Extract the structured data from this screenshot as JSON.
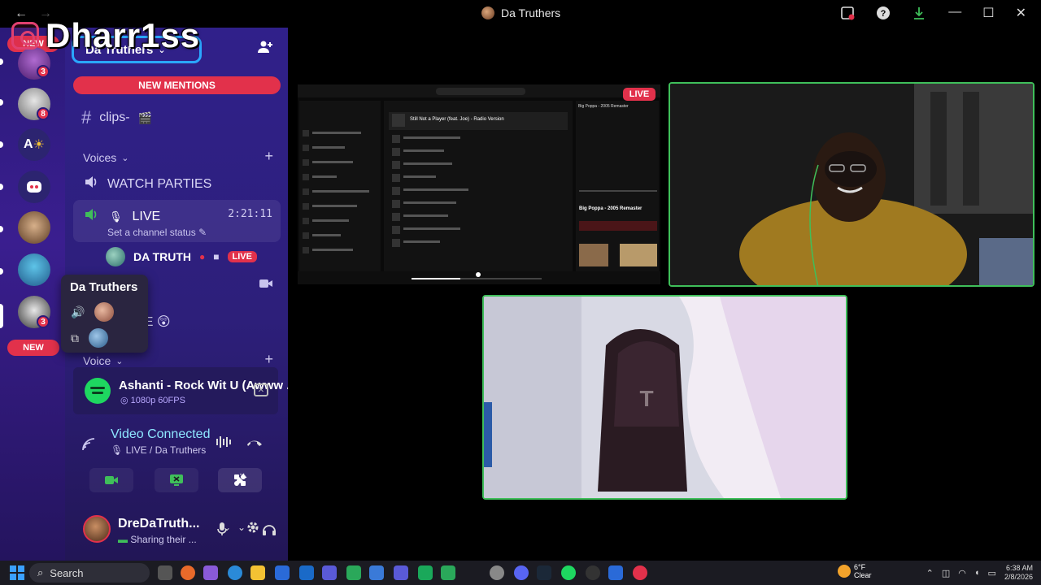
{
  "window": {
    "title": "Da Truthers",
    "back_arrow": "←",
    "forward_arrow": "→",
    "icons": [
      "inbox-icon",
      "help-icon",
      "download-icon"
    ],
    "controls": [
      "—",
      "☐",
      "✕"
    ]
  },
  "overlay": {
    "streamer_name": "Dharr1ss"
  },
  "server_rail": {
    "new_top_label": "NEW",
    "new_bottom_label": "NEW",
    "badges": [
      "3",
      "8",
      "3"
    ],
    "text_server_label": "A"
  },
  "sidebar": {
    "server_name": "Da Truthers",
    "new_mentions": "NEW MENTIONS",
    "text_channel": "clips-",
    "voice_category": "Voices",
    "watch_parties": "WATCH PARTIES",
    "live_channel": "LIVE",
    "live_timer": "2:21:11",
    "channel_status": "Set a channel status",
    "member_name": "DA TRUTH",
    "member_live_badge": "LIVE",
    "partial_channel": "TE",
    "voice_category_2": "Voice"
  },
  "tooltip": {
    "title": "Da Truthers"
  },
  "now_playing": {
    "title": "Ashanti - Rock Wit U (Awww ...",
    "quality": "1080p 60FPS"
  },
  "voice_connected": {
    "title": "Video Connected",
    "subtitle": "LIVE / Da Truthers"
  },
  "user_panel": {
    "name": "DreDaTruth...",
    "status": "Sharing their ..."
  },
  "stage": {
    "live_badge": "LIVE",
    "shared_screen": {
      "now_playing": "Still Not a Player (feat. Joe) - Radio Version",
      "side_title": "Big Poppa - 2005 Remaster",
      "side_panel_title": "Big Poppa - 2005 Remaster"
    }
  },
  "taskbar": {
    "search_label": "Search",
    "weather_temp": "6°F",
    "weather_desc": "Clear",
    "time": "6:38 AM",
    "date": "2/8/2026"
  }
}
